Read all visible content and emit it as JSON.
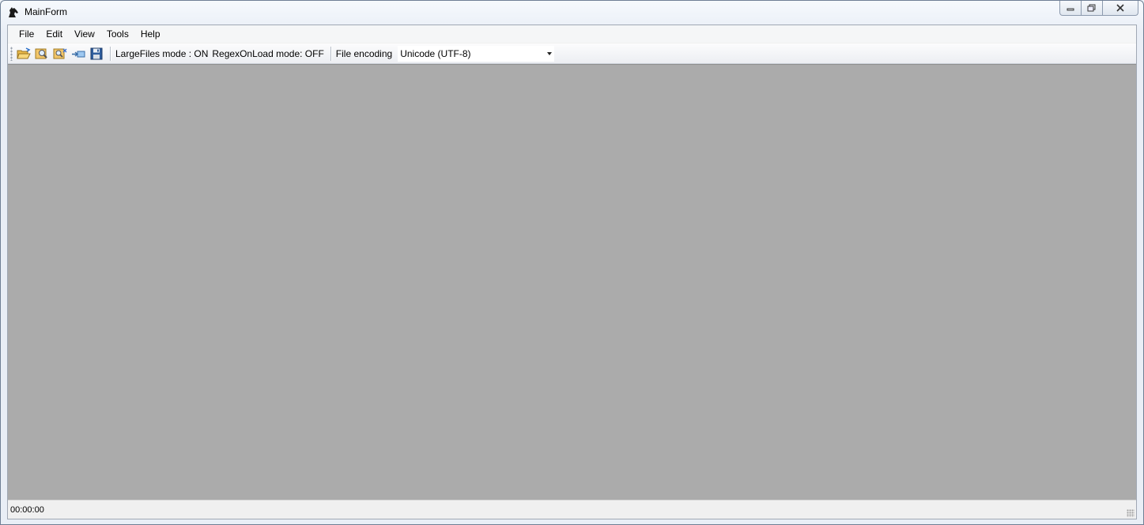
{
  "window": {
    "title": "MainForm",
    "caption_buttons": [
      "minimize-icon",
      "maximize-icon",
      "close-icon"
    ]
  },
  "menu": {
    "items": [
      "File",
      "Edit",
      "View",
      "Tools",
      "Help"
    ]
  },
  "toolbar": {
    "icons": [
      "open-folder-icon",
      "find-icon",
      "find-replace-icon",
      "export-icon",
      "save-icon"
    ],
    "large_files_mode": "LargeFiles mode : ON",
    "regex_on_load_mode": "RegexOnLoad mode: OFF",
    "file_encoding_label": "File encoding",
    "file_encoding_value": "Unicode (UTF-8)"
  },
  "status": {
    "elapsed_time": "00:00:00"
  },
  "colors": {
    "mdi_background": "#ababab",
    "chrome": "#f0f0f0"
  }
}
